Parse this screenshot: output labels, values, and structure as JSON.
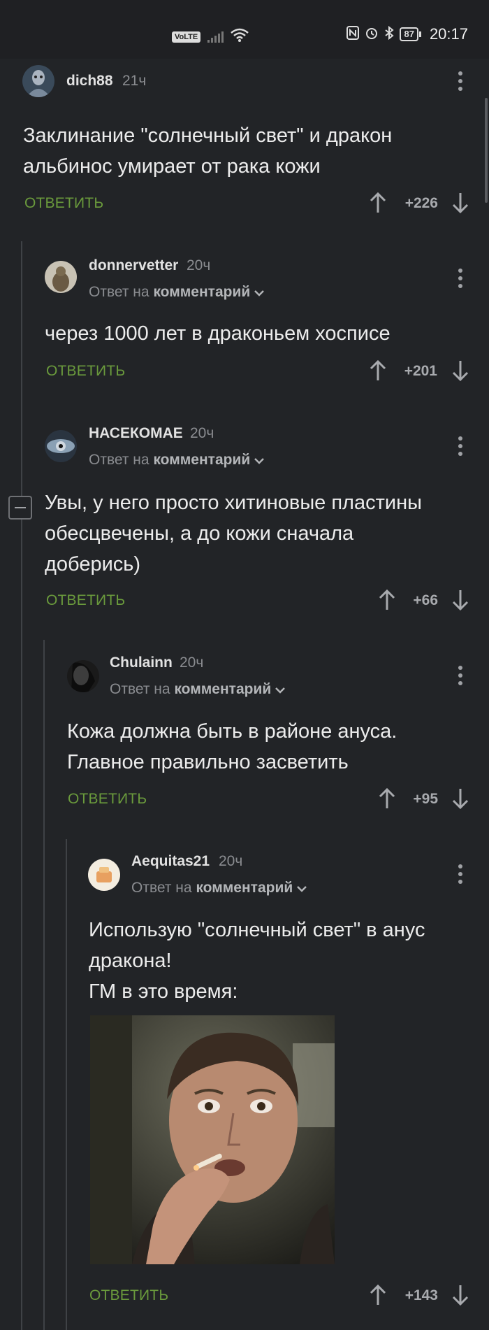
{
  "status_bar": {
    "volte": "VoLTE",
    "wifi_tag": "6",
    "battery": "87",
    "time": "20:17"
  },
  "ui": {
    "reply_label": "ОТВЕТИТЬ",
    "reply_to_prefix": "Ответ на",
    "reply_to_link": "комментарий"
  },
  "comments": [
    {
      "author": "dich88",
      "time": "21ч",
      "text_lines": [
        "Заклинание \"солнечный свет\" и дракон",
        "альбинос умирает от рака кожи"
      ],
      "score": "+226"
    },
    {
      "author": "donnervetter",
      "time": "20ч",
      "text_lines": [
        "через 1000 лет в драконьем хосписе"
      ],
      "score": "+201"
    },
    {
      "author": "НАСЕКОМАЕ",
      "time": "20ч",
      "text_lines": [
        "Увы, у него просто хитиновые пластины",
        "обесцвечены, а до кожи сначала",
        "доберись)"
      ],
      "score": "+66"
    },
    {
      "author": "Chulainn",
      "time": "20ч",
      "text_lines": [
        "Кожа должна быть в районе ануса.",
        "Главное правильно засветить"
      ],
      "score": "+95"
    },
    {
      "author": "Aequitas21",
      "time": "20ч",
      "text_lines": [
        "Использую \"солнечный свет\" в анус",
        "дракона!",
        "ГМ в это время:"
      ],
      "score": "+143"
    }
  ],
  "icons": {
    "vote_up": "arrow-up-icon",
    "vote_down": "arrow-down-icon",
    "more": "more-vertical-icon",
    "collapse": "collapse-minus-icon"
  }
}
